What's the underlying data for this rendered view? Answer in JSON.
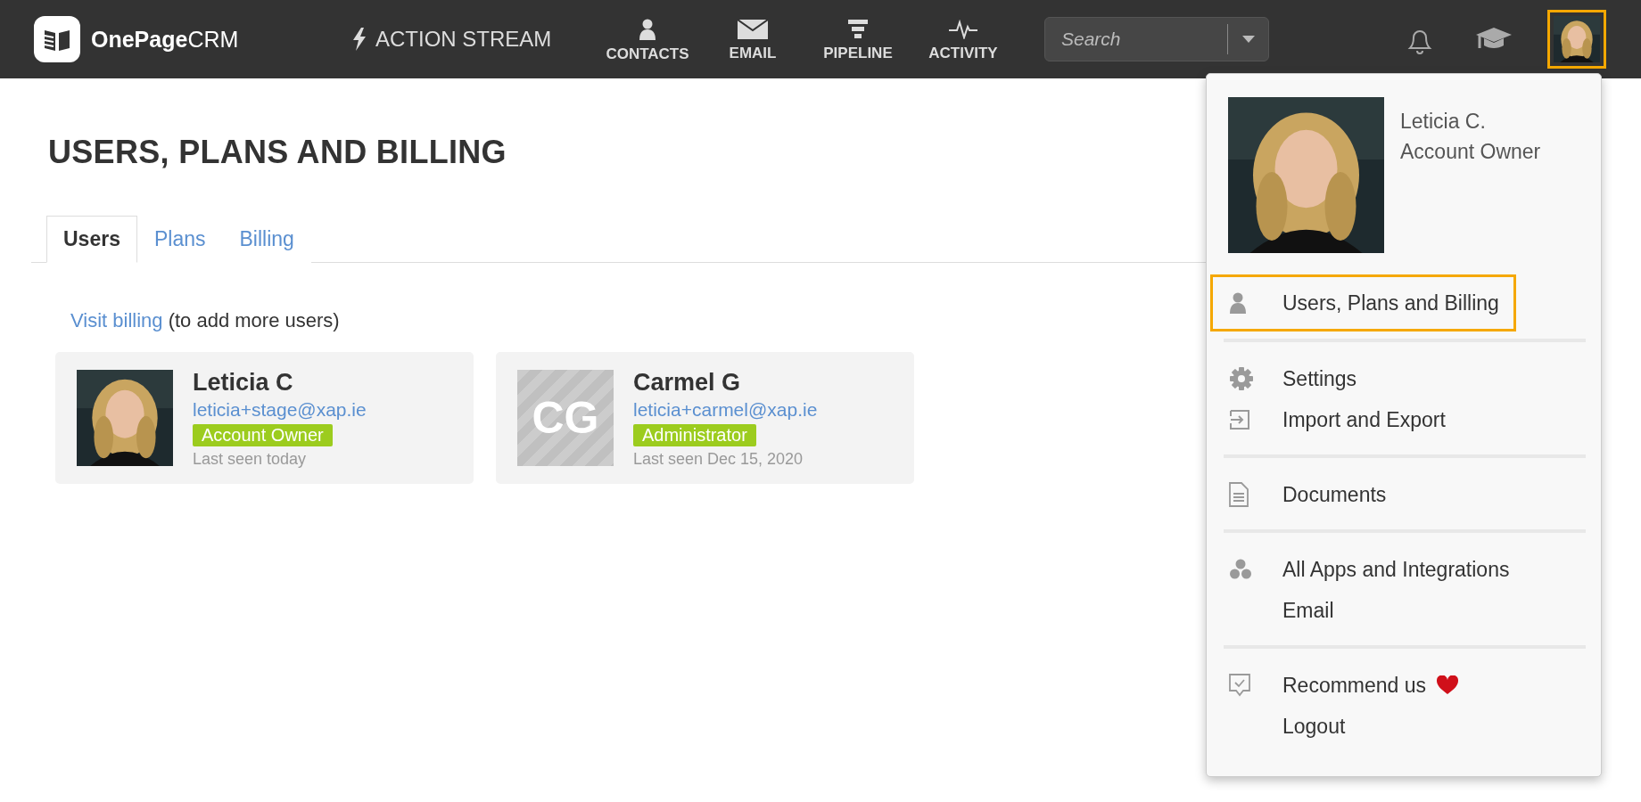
{
  "topbar": {
    "logo": {
      "brand": "OnePage",
      "suffix": "CRM"
    },
    "action_stream": "ACTION STREAM",
    "nav": [
      {
        "label": "CONTACTS",
        "selected": false
      },
      {
        "label": "EMAIL",
        "selected": false
      },
      {
        "label": "PIPELINE",
        "selected": false
      },
      {
        "label": "ACTIVITY",
        "selected": false
      }
    ],
    "search": {
      "placeholder": "Search"
    },
    "account_button": {
      "selected": true
    }
  },
  "page": {
    "title": "USERS, PLANS AND BILLING",
    "tabs": [
      {
        "label": "Users",
        "selected": true
      },
      {
        "label": "Plans",
        "selected": false
      },
      {
        "label": "Billing",
        "selected": false
      }
    ],
    "notice": {
      "link": "Visit billing",
      "text": "(to add more users)"
    },
    "users": [
      {
        "name": "Leticia C",
        "email": "leticia+stage@xap.ie",
        "role": "Account Owner",
        "last_seen": "Last seen today"
      },
      {
        "avatar": {
          "kind": "initials",
          "initials": "CG"
        },
        "name": "Carmel G",
        "email": "leticia+carmel@xap.ie",
        "role": "Administrator",
        "last_seen": "Last seen Dec 15, 2020"
      }
    ]
  },
  "account_menu": {
    "name": "Leticia C.",
    "role": "Account Owner",
    "sections": [
      [
        {
          "label": "Users, Plans and Billing",
          "selected": true
        }
      ],
      [
        {
          "label": "Settings",
          "selected": false
        },
        {
          "label": "Import and Export",
          "selected": false
        }
      ],
      [
        {
          "label": "Documents",
          "selected": false
        }
      ],
      [
        {
          "label": "All Apps and Integrations",
          "selected": false
        },
        {
          "label": "Email",
          "selected": false
        }
      ],
      [
        {
          "label": "Recommend us",
          "selected": false,
          "heart": true
        },
        {
          "label": "Logout",
          "selected": false
        }
      ]
    ]
  }
}
